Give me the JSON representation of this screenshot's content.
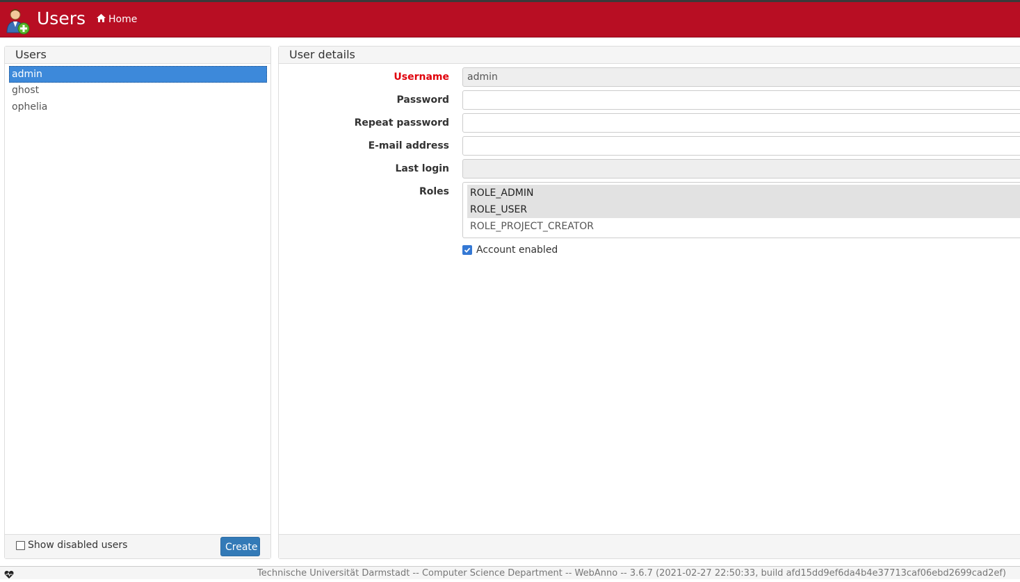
{
  "header": {
    "title": "Users",
    "home_label": "Home",
    "icon": "user-add-icon",
    "background_color": "#b80e23"
  },
  "users_panel": {
    "heading": "Users",
    "items": [
      {
        "label": "admin",
        "selected": true
      },
      {
        "label": "ghost",
        "selected": false
      },
      {
        "label": "ophelia",
        "selected": false
      }
    ],
    "show_disabled_label": "Show disabled users",
    "show_disabled_checked": false,
    "create_label": "Create"
  },
  "details_panel": {
    "heading": "User details",
    "username": {
      "label": "Username",
      "value": "admin",
      "required": true
    },
    "password": {
      "label": "Password",
      "value": ""
    },
    "repeat_password": {
      "label": "Repeat password",
      "value": ""
    },
    "email": {
      "label": "E-mail address",
      "value": ""
    },
    "last_login": {
      "label": "Last login",
      "value": ""
    },
    "roles": {
      "label": "Roles",
      "options": [
        {
          "label": "ROLE_ADMIN",
          "selected": true
        },
        {
          "label": "ROLE_USER",
          "selected": true
        },
        {
          "label": "ROLE_PROJECT_CREATOR",
          "selected": false
        }
      ]
    },
    "account_enabled_label": "Account enabled",
    "account_enabled_checked": true
  },
  "footer": {
    "text": "Technische Universität Darmstadt -- Computer Science Department -- WebAnno -- 3.6.7 (2021-02-27 22:50:33, build afd15dd9ef6da4b4e37713caf06ebd2699cad2ef)",
    "icon": "heartbeat-icon"
  }
}
